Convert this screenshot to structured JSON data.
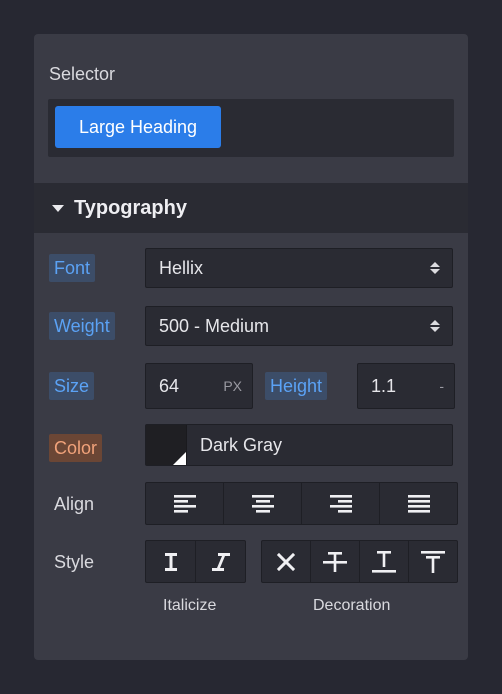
{
  "selector": {
    "label": "Selector",
    "chip": "Large Heading"
  },
  "section": {
    "title": "Typography"
  },
  "font": {
    "label": "Font",
    "value": "Hellix"
  },
  "weight": {
    "label": "Weight",
    "value": "500 - Medium"
  },
  "size": {
    "label": "Size",
    "value": "64",
    "unit": "PX"
  },
  "height": {
    "label": "Height",
    "value": "1.1",
    "unit": "-"
  },
  "color": {
    "label": "Color",
    "value": "Dark Gray",
    "swatch": "#1f1f23"
  },
  "align": {
    "label": "Align",
    "options": [
      "align-left-icon",
      "align-center-icon",
      "align-right-icon",
      "align-justify-icon"
    ]
  },
  "style": {
    "label": "Style",
    "italicize_caption": "Italicize",
    "decoration_caption": "Decoration",
    "italicize_options": [
      "upright-icon",
      "italic-icon"
    ],
    "decoration_options": [
      "none-icon",
      "strikethrough-icon",
      "underline-icon",
      "overline-icon"
    ]
  },
  "colors": {
    "accent": "#2b7de9",
    "label_blue": "#5ba2f5",
    "label_orange": "#f1a27a"
  }
}
